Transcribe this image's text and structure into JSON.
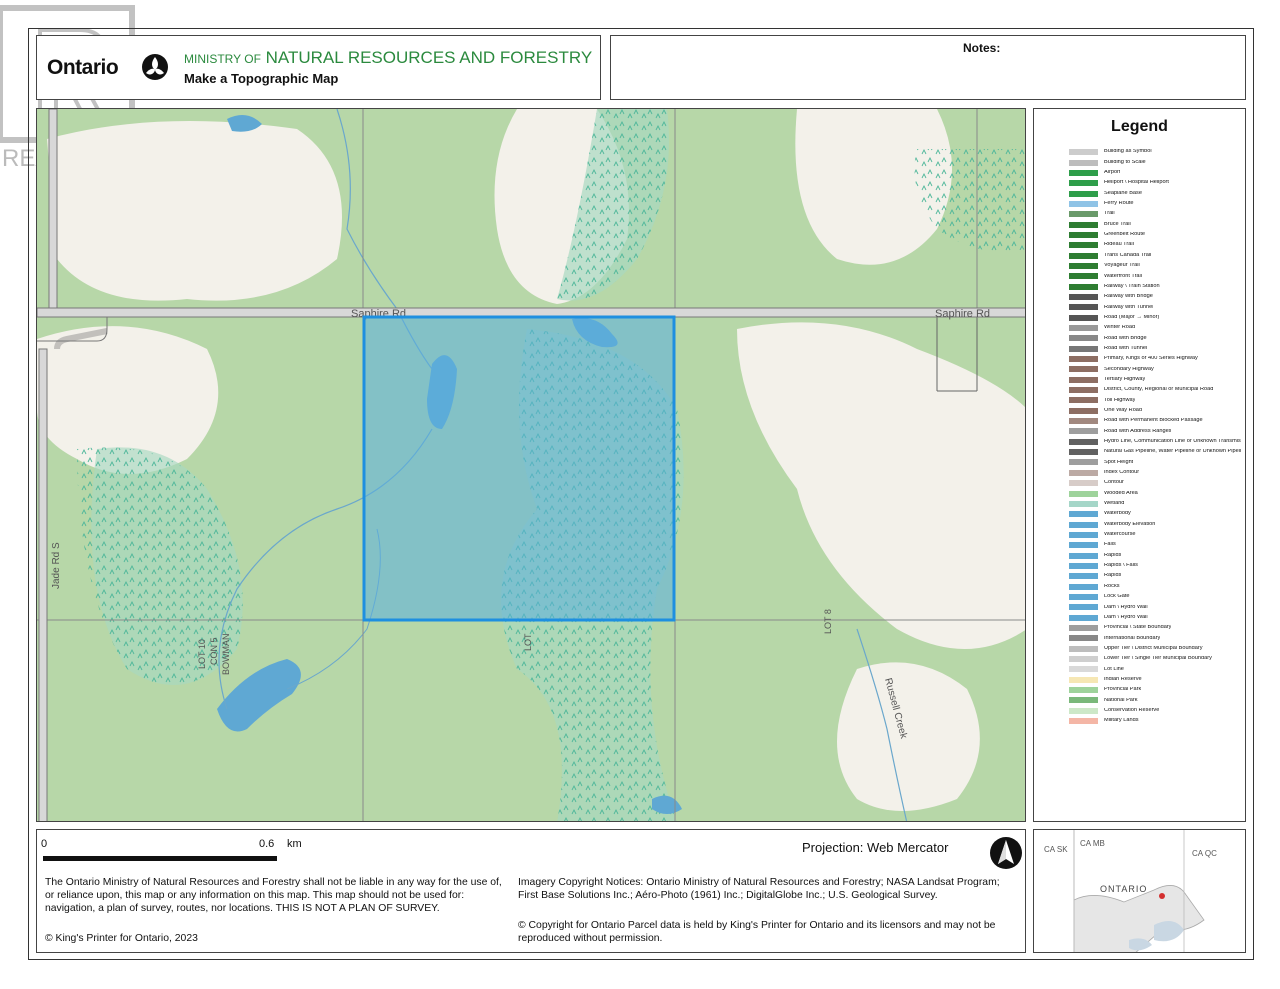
{
  "header": {
    "brand": "Ontario",
    "ministry_prefix": "MINISTRY OF",
    "ministry_name": "NATURAL RESOURCES AND FORESTRY",
    "subtitle": "Make a Topographic Map"
  },
  "notes": {
    "label": "Notes:"
  },
  "map": {
    "labels": {
      "road_north": "Saphire Rd",
      "road_north_east": "Saphire Rd",
      "road_west": "Jade Rd S",
      "lot_west_1": "LOT 10",
      "lot_west_2": "CON 5",
      "lot_west_3": "BOWMAN",
      "lot_center": "LOT",
      "lot_east": "LOT 8",
      "creek": "Russell Creek"
    },
    "colors": {
      "land": "#b7d7a8",
      "open": "#f3f1ea",
      "water": "#5fa8d3",
      "parcel_fill": "#5aaede",
      "parcel_outline": "#1e8fe0"
    }
  },
  "legend": {
    "title": "Legend",
    "items": [
      "Building as Symbol",
      "Building to Scale",
      "Airport",
      "Heliport \\ Hospital Heliport",
      "Seaplane Base",
      "Ferry Route",
      "Trail",
      "Bruce Trail",
      "Greenbelt Route",
      "Rideau Trail",
      "Trans Canada Trail",
      "Voyageur Trail",
      "Waterfront Trail",
      "Railway \\ Train Station",
      "Railway with Bridge",
      "Railway with Tunnel",
      "Road (Major → Minor)",
      "Winter Road",
      "Road with Bridge",
      "Road with Tunnel",
      "Primary, Kings or 400 Series Highway",
      "Secondary Highway",
      "Tertiary Highway",
      "District, County, Regional or Municipal Road",
      "Toll Highway",
      "One Way Road",
      "Road with Permanent Blocked Passage",
      "Road with Address Ranges",
      "Hydro Line, Communication Line or Unknown Transmission Line",
      "Natural Gas Pipeline, Water Pipeline or Unknown Pipeline",
      "Spot Height",
      "Index Contour",
      "Contour",
      "Wooded Area",
      "Wetland",
      "Waterbody",
      "Waterbody Elevation",
      "Watercourse",
      "Falls",
      "Rapids",
      "Rapids \\ Falls",
      "Rapids",
      "Rocks",
      "Lock Gate",
      "Dam \\ Hydro Wall",
      "Dam \\ Hydro Wall",
      "Provincial \\ State Boundary",
      "International Boundary",
      "Upper Tier \\ District Municipal Boundary",
      "Lower Tier \\ Single Tier Municipal Boundary",
      "Lot Line",
      "Indian Reserve",
      "Provincial Park",
      "National Park",
      "Conservation Reserve",
      "Military Lands"
    ],
    "symbol_colors": [
      "#cccccc",
      "#bdbdbd",
      "#2e9e4a",
      "#2e9e4a",
      "#2e9e4a",
      "#8fc3e6",
      "#6a9a6a",
      "#2e7d32",
      "#2e7d32",
      "#2e7d32",
      "#2e7d32",
      "#2e7d32",
      "#2e7d32",
      "#2e7d32",
      "#555555",
      "#555555",
      "#555555",
      "#999999",
      "#888888",
      "#777777",
      "#8d6e63",
      "#8d6e63",
      "#8d6e63",
      "#8d6e63",
      "#8d6e63",
      "#8d6e63",
      "#a1887f",
      "#9e9e9e",
      "#616161",
      "#616161",
      "#9e9e9e",
      "#bcaaa4",
      "#d7ccc8",
      "#9ed39b",
      "#a5d6c8",
      "#5fa8d3",
      "#5fa8d3",
      "#5fa8d3",
      "#5fa8d3",
      "#5fa8d3",
      "#5fa8d3",
      "#5fa8d3",
      "#5fa8d3",
      "#5fa8d3",
      "#5fa8d3",
      "#5fa8d3",
      "#9e9e9e",
      "#888888",
      "#bdbdbd",
      "#cfcfcf",
      "#d9d9d9",
      "#f6e7b4",
      "#9ed39b",
      "#7ab87a",
      "#cde8c8",
      "#f4b6a6"
    ]
  },
  "footer": {
    "scale": {
      "start": "0",
      "end": "0.6",
      "unit": "km"
    },
    "projection": "Projection: Web Mercator",
    "disclaimer": "The Ontario Ministry of Natural Resources and Forestry shall not be liable in any way for the use of, or reliance upon, this map or any information on this map.  This map should not be used for: navigation, a plan of survey, routes, nor locations. THIS IS NOT A PLAN OF SURVEY.",
    "copyright": "© King's Printer for Ontario,  2023",
    "imagery": "Imagery Copyright Notices: Ontario Ministry of Natural Resources and Forestry; NASA Landsat Program; First Base Solutions Inc.; Aéro-Photo (1961) Inc.; DigitalGlobe Inc.; U.S. Geological Survey.",
    "parcel": "© Copyright for Ontario Parcel data is held by King's Printer for Ontario and its licensors and may not be reproduced without permission."
  },
  "inset": {
    "labels": {
      "ca_sk": "CA\nSK",
      "ca_mb": "CA\nMB",
      "ca_qc": "CA\nQC",
      "province": "ONTARIO"
    }
  },
  "overlay": {
    "realtor": "REALTOR",
    "watermark": "ROYAL LEPAGE"
  }
}
